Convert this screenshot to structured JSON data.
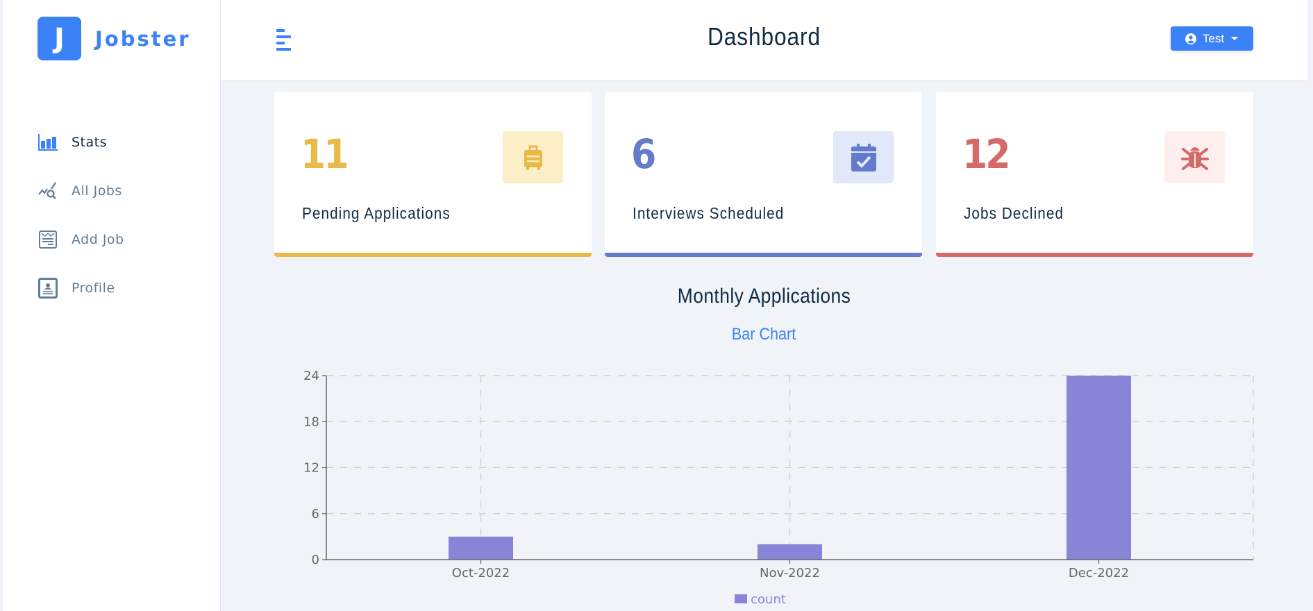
{
  "app": {
    "logo_letter": "J",
    "name": "Jobster"
  },
  "sidebar": {
    "items": [
      {
        "label": "Stats",
        "icon": "bar-chart-icon",
        "active": true
      },
      {
        "label": "All Jobs",
        "icon": "chart-search-icon",
        "active": false
      },
      {
        "label": "Add Job",
        "icon": "form-icon",
        "active": false
      },
      {
        "label": "Profile",
        "icon": "id-card-icon",
        "active": false
      }
    ]
  },
  "navbar": {
    "toggle_icon": "menu-icon",
    "title": "Dashboard",
    "user": {
      "name": "Test",
      "icon": "user-circle-icon",
      "caret": "caret-down-icon"
    }
  },
  "stats": [
    {
      "count": "11",
      "title": "Pending Applications",
      "icon": "suitcase-icon",
      "color": "#e9b949",
      "bg": "#fcefc7"
    },
    {
      "count": "6",
      "title": "Interviews Scheduled",
      "icon": "calendar-check-icon",
      "color": "#647acb",
      "bg": "#e0e8f9"
    },
    {
      "count": "12",
      "title": "Jobs Declined",
      "icon": "bug-icon",
      "color": "#d66a6a",
      "bg": "#ffeeee"
    }
  ],
  "chart_section": {
    "heading": "Monthly Applications",
    "toggle_label": "Bar Chart"
  },
  "chart_data": {
    "type": "bar",
    "title": "Monthly Applications",
    "categories": [
      "Oct-2022",
      "Nov-2022",
      "Dec-2022"
    ],
    "series": [
      {
        "name": "count",
        "values": [
          3,
          2,
          24
        ],
        "color": "#8884d8"
      }
    ],
    "xlabel": "",
    "ylabel": "",
    "ylim": [
      0,
      24
    ],
    "yticks": [
      0,
      6,
      12,
      18,
      24
    ],
    "grid": true,
    "legend": "bottom-center"
  }
}
